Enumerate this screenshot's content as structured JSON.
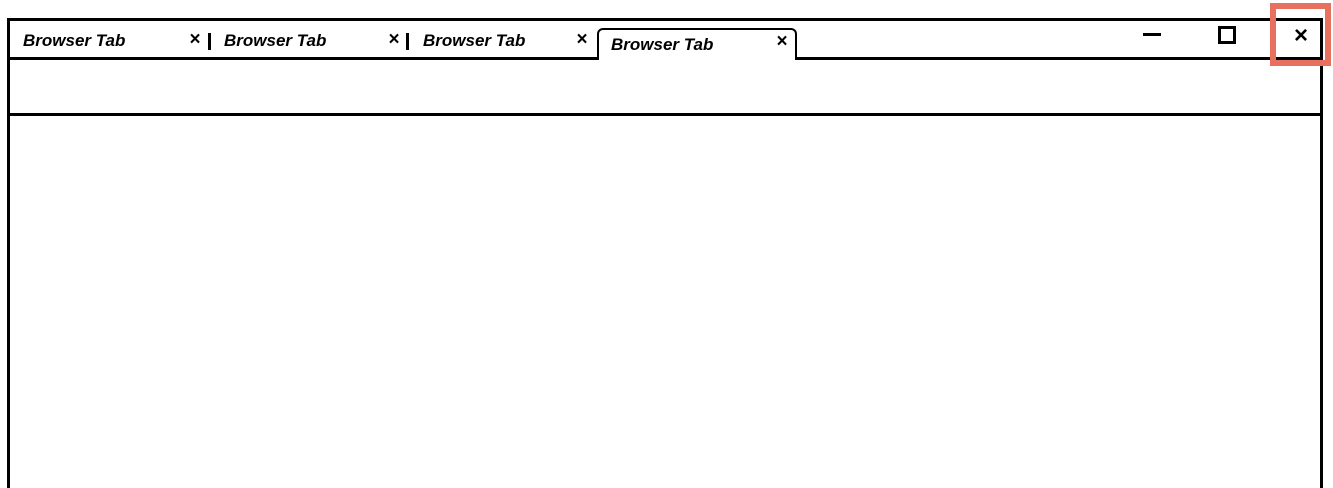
{
  "tabs": [
    {
      "label": "Browser Tab",
      "close_icon": "×",
      "active": false
    },
    {
      "label": "Browser Tab",
      "close_icon": "×",
      "active": false
    },
    {
      "label": "Browser Tab",
      "close_icon": "×",
      "active": false
    },
    {
      "label": "Browser Tab",
      "close_icon": "×",
      "active": true
    }
  ],
  "window_controls": {
    "minimize_icon": "minimize-icon",
    "maximize_icon": "maximize-icon",
    "close_icon": "×"
  },
  "highlight_color": "#e8705f"
}
